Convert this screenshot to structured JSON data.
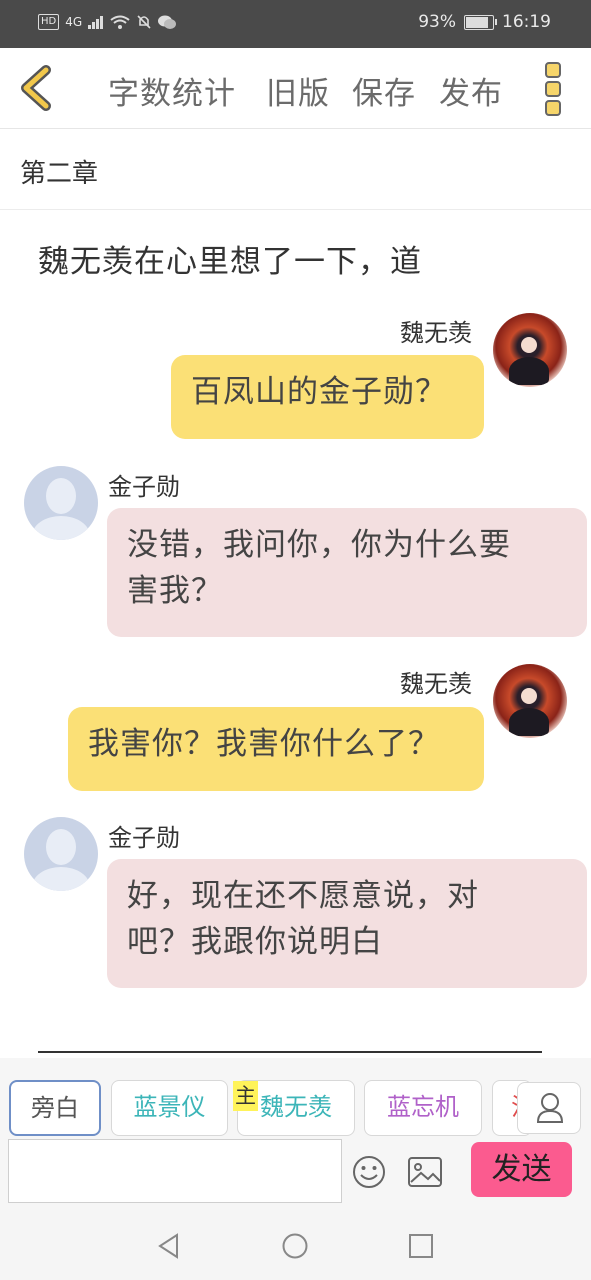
{
  "status_bar": {
    "left_labels": [
      "HD",
      "4G"
    ],
    "battery_text": "93%",
    "battery_level_percent": 93,
    "time": "16:19"
  },
  "toolbar": {
    "back_icon": "chevron-left-icon",
    "items": [
      "字数统计",
      "旧版",
      "保存",
      "发布"
    ],
    "menu_icon": "more-vertical-icon",
    "accent_color": "#f6d56a"
  },
  "chapter": {
    "title": "第二章"
  },
  "story": {
    "narration": "魏无羡在心里想了一下，道",
    "messages": [
      {
        "speaker": "魏无羡",
        "side": "right",
        "lines": [
          "百凤山的金子勋？"
        ]
      },
      {
        "speaker": "金子勋",
        "side": "left",
        "lines": [
          "没错，我问你，你为什么要",
          "害我？"
        ]
      },
      {
        "speaker": "魏无羡",
        "side": "right",
        "lines": [
          "我害你？我害你什么了？"
        ]
      },
      {
        "speaker": "金子勋",
        "side": "left",
        "lines": [
          "好，现在还不愿意说，对",
          "吧？我跟你说明白"
        ]
      }
    ],
    "colors": {
      "right_bubble": "#fbe076",
      "left_bubble": "#f3dfe0"
    }
  },
  "roles": {
    "chips": [
      {
        "label": "旁白",
        "color": "#555555",
        "active": true
      },
      {
        "label": "蓝景仪",
        "color": "#3cb5b8"
      },
      {
        "label": "魏无羡",
        "color": "#3cb5b8"
      },
      {
        "label": "蓝忘机",
        "color": "#b061c9"
      },
      {
        "label": "江",
        "color": "#e04d4d"
      }
    ],
    "main_badge": "主",
    "user_icon": "user-icon"
  },
  "composer": {
    "input_value": "",
    "input_placeholder": "",
    "emoji_icon": "emoji-icon",
    "image_icon": "image-icon",
    "send_label": "发送",
    "send_color": "#fb5b8f"
  },
  "nav_bar": {
    "icons": [
      "back-triangle-icon",
      "home-circle-icon",
      "recents-square-icon"
    ]
  }
}
